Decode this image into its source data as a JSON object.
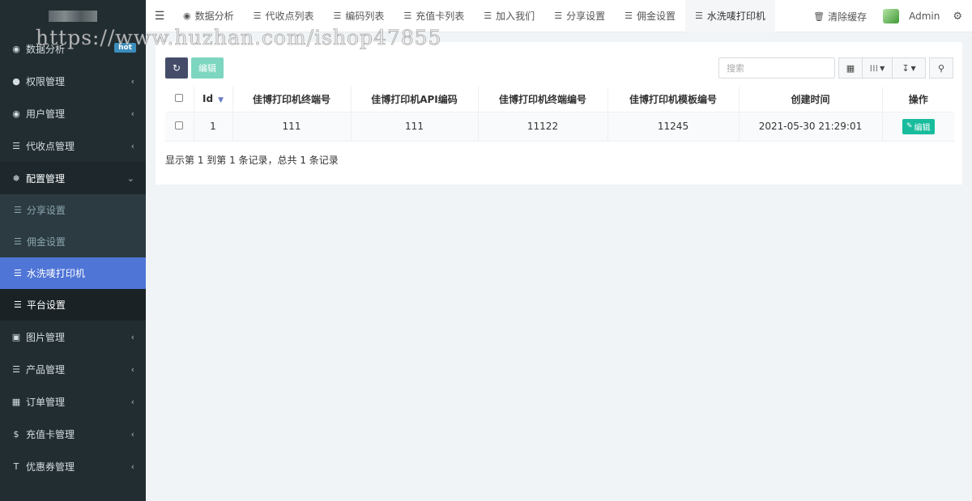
{
  "watermark": "https://www.huzhan.com/ishop47855",
  "sidebar": {
    "items": [
      {
        "label": "数据分析",
        "icon": "dashboard-icon",
        "badge": "hot"
      },
      {
        "label": "权限管理",
        "icon": "users-icon"
      },
      {
        "label": "用户管理",
        "icon": "user-circle-icon"
      },
      {
        "label": "代收点管理",
        "icon": "list-icon"
      },
      {
        "label": "配置管理",
        "icon": "gear-icon"
      },
      {
        "label": "图片管理",
        "icon": "image-icon"
      },
      {
        "label": "产品管理",
        "icon": "list-alt-icon"
      },
      {
        "label": "订单管理",
        "icon": "table-icon"
      },
      {
        "label": "充值卡管理",
        "icon": "dollar-icon"
      },
      {
        "label": "优惠券管理",
        "icon": "text-icon"
      }
    ],
    "sub_items": [
      {
        "label": "分享设置",
        "icon": "list-icon"
      },
      {
        "label": "佣金设置",
        "icon": "list-icon"
      },
      {
        "label": "水洗唛打印机",
        "icon": "list-icon"
      },
      {
        "label": "平台设置",
        "icon": "list-icon"
      }
    ]
  },
  "topbar": {
    "tabs": [
      {
        "label": "数据分析",
        "icon": "dashboard-icon"
      },
      {
        "label": "代收点列表",
        "icon": "list-icon"
      },
      {
        "label": "编码列表",
        "icon": "list-icon"
      },
      {
        "label": "充值卡列表",
        "icon": "list-icon"
      },
      {
        "label": "加入我们",
        "icon": "list-icon"
      },
      {
        "label": "分享设置",
        "icon": "list-icon"
      },
      {
        "label": "佣金设置",
        "icon": "list-icon"
      },
      {
        "label": "水洗唛打印机",
        "icon": "list-icon"
      }
    ],
    "clear_cache": "清除缓存",
    "user": "Admin"
  },
  "toolbar": {
    "edit_label": "编辑",
    "search_placeholder": "搜索"
  },
  "table": {
    "headers": [
      "Id",
      "佳博打印机终端号",
      "佳博打印机API编码",
      "佳博打印机终端编号",
      "佳博打印机模板编号",
      "创建时间",
      "操作"
    ],
    "rows": [
      {
        "id": "1",
        "terminal": "111",
        "api_code": "111",
        "terminal_no": "11122",
        "template_no": "11245",
        "created": "2021-05-30 21:29:01",
        "action": "编辑"
      }
    ]
  },
  "summary": "显示第 1 到第 1 条记录，总共 1 条记录",
  "colors": {
    "sidebar_bg": "#222d32",
    "active_item": "#4f75d6",
    "edit_btn": "#18bc9c"
  }
}
